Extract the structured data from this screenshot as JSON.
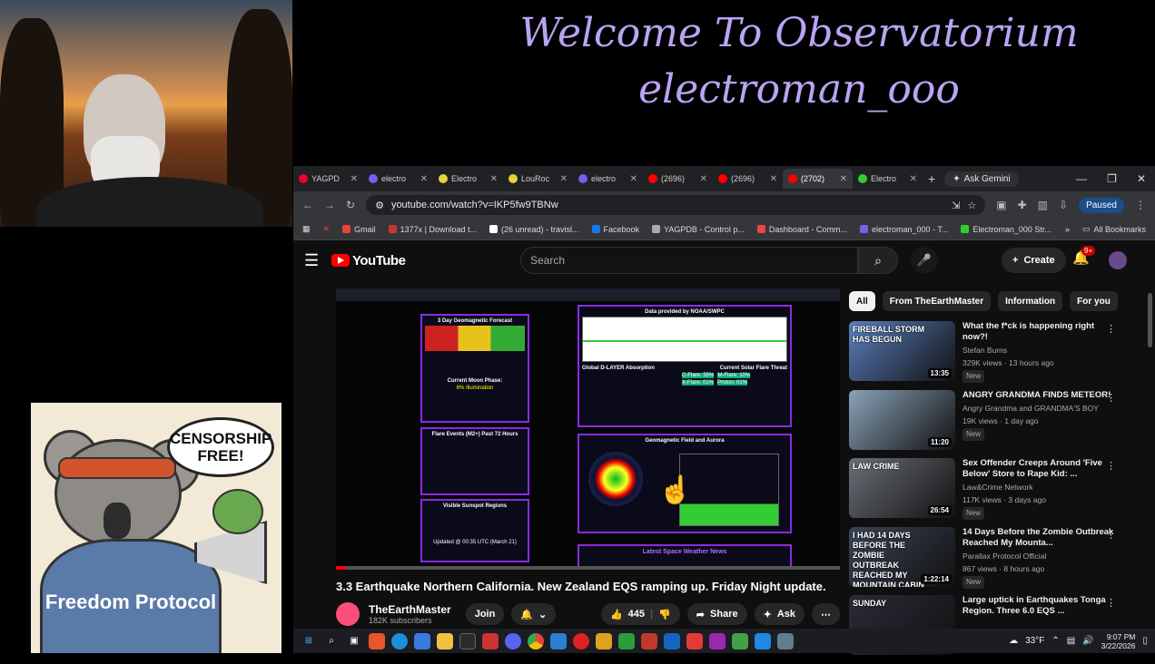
{
  "overlay": {
    "line1": "Welcome To Observatorium",
    "line2": "electroman_ooo"
  },
  "sticker": {
    "bubble": "CENSORSHIP FREE!",
    "hoodie": "Freedom Protocol"
  },
  "tabs": [
    {
      "label": "YAGPD",
      "color": "#e03"
    },
    {
      "label": "electro",
      "color": "#7b5cf0"
    },
    {
      "label": "Electro",
      "color": "#e8d23a"
    },
    {
      "label": "LouRoc",
      "color": "#e8d23a"
    },
    {
      "label": "electro",
      "color": "#7b5cf0"
    },
    {
      "label": "(2696)",
      "color": "#f00"
    },
    {
      "label": "(2696)",
      "color": "#f00"
    },
    {
      "label": "(2702)",
      "color": "#f00"
    },
    {
      "label": "Electro",
      "color": "#3c3"
    }
  ],
  "browser": {
    "ask_gemini": "Ask Gemini",
    "url": "youtube.com/watch?v=IKP5fw9TBNw",
    "paused": "Paused",
    "all_bookmarks": "All Bookmarks"
  },
  "bookmarks": [
    {
      "label": "Gmail",
      "color": "#ea4335"
    },
    {
      "label": "1377x | Download t...",
      "color": "#c33"
    },
    {
      "label": "(26 unread) - travisl...",
      "color": "#fff"
    },
    {
      "label": "Facebook",
      "color": "#1877f2"
    },
    {
      "label": "YAGPDB - Control p...",
      "color": "#aaa"
    },
    {
      "label": "Dashboard - Comm...",
      "color": "#e44"
    },
    {
      "label": "electroman_000 - T...",
      "color": "#7b5cf0"
    },
    {
      "label": "Electroman_000 Str...",
      "color": "#3c3"
    }
  ],
  "youtube": {
    "logo": "YouTube",
    "search_placeholder": "Search",
    "create": "Create",
    "notif_count": "9+"
  },
  "player": {
    "forecast_title": "3 Day Geomagnetic Forecast",
    "moon_title": "Current Moon Phase:",
    "moon_value": "6% Illumination",
    "flare_title": "Flare Events (M2+) Past 72 Hours",
    "sunspot_title": "Visible Sunspot Regions",
    "xray_title": "Data provided by NOAA/SWPC",
    "dlayer_title": "Global D-LAYER Absorption",
    "solar_flare_title": "Current Solar Flare Threat",
    "c_flare": "C-Flare: 55%",
    "m_flare": "M-Flare: 10%",
    "x_flare": "X-Flare: 01%",
    "proton": "Proton: 01%",
    "aurora_title": "Geomagnetic Field and Aurora",
    "news_title": "Latest Space Weather News",
    "updated": "Updated @ 00:35 UTC (March 21)",
    "progress": 0.02
  },
  "video": {
    "title": "3.3 Earthquake Northern California. New Zealand EQS ramping up. Friday Night update.",
    "channel": "TheEarthMaster",
    "subs": "182K subscribers",
    "join": "Join",
    "likes": "445",
    "share": "Share",
    "ask": "Ask"
  },
  "chips": [
    "All",
    "From TheEarthMaster",
    "Information",
    "For you"
  ],
  "recommendations": [
    {
      "title": "What the f*ck is happening right now?!",
      "channel": "Stefan Burns",
      "meta": "329K views · 13 hours ago",
      "duration": "13:35",
      "thumb_text": "FIREBALL STORM HAS BEGUN",
      "color": "#5a7fbf"
    },
    {
      "title": "ANGRY GRANDMA FINDS METEOR!",
      "channel": "Angry Grandma and GRANDMA'S BOY",
      "meta": "19K views · 1 day ago",
      "duration": "11:20",
      "thumb_text": "",
      "color": "#8aa2b8"
    },
    {
      "title": "Sex Offender Creeps Around 'Five Below' Store to Rape Kid: ...",
      "channel": "Law&Crime Network",
      "meta": "117K views · 3 days ago",
      "duration": "26:54",
      "thumb_text": "LAW CRIME",
      "color": "#6b6f78"
    },
    {
      "title": "14 Days Before the Zombie Outbreak Reached My Mounta...",
      "channel": "Parallax Protocol Official",
      "meta": "867 views · 8 hours ago",
      "duration": "1:22:14",
      "thumb_text": "I HAD 14 DAYS BEFORE THE ZOMBIE OUTBREAK REACHED MY MOUNTAIN CABIN",
      "color": "#3a4456"
    },
    {
      "title": "Large uptick in Earthquakes Tonga Region. Three 6.0 EQS ...",
      "channel": "",
      "meta": "",
      "duration": "",
      "thumb_text": "SUNDAY",
      "color": "#2b2b3a"
    }
  ],
  "new_label": "New",
  "taskbar": {
    "weather": "33°F",
    "time": "9:07 PM",
    "date": "3/22/2026"
  }
}
